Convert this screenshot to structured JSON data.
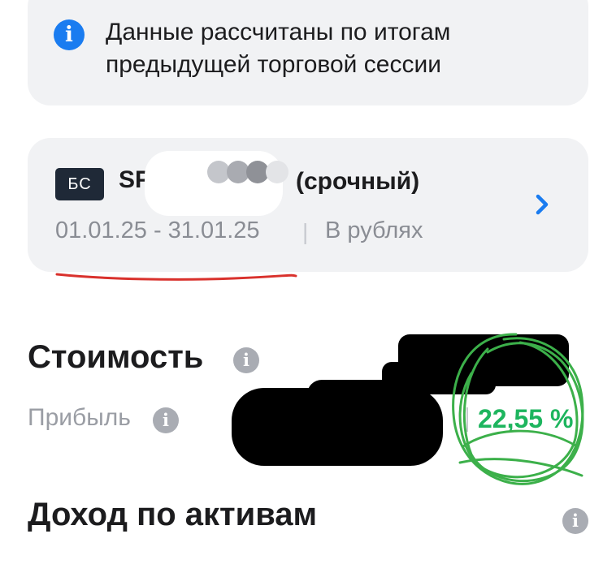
{
  "info_banner": {
    "icon": "info-icon",
    "icon_glyph": "i",
    "text_line1": "Данные рассчитаны по итогам",
    "text_line2": "предыдущей торговой сессии",
    "accent": "#1a7cf0"
  },
  "account": {
    "badge": "БС",
    "name_visible": "SP",
    "type": "(срочный)",
    "period": "01.01.25 - 31.01.25",
    "separator": "|",
    "currency": "В рублях"
  },
  "value_section": {
    "title": "Стоимость",
    "info_glyph": "i",
    "profit_label": "Прибыль",
    "profit_percent": "22,55 %",
    "profit_color": "#1db55e"
  },
  "income_section": {
    "title": "Доход по активам",
    "info_glyph": "i"
  }
}
